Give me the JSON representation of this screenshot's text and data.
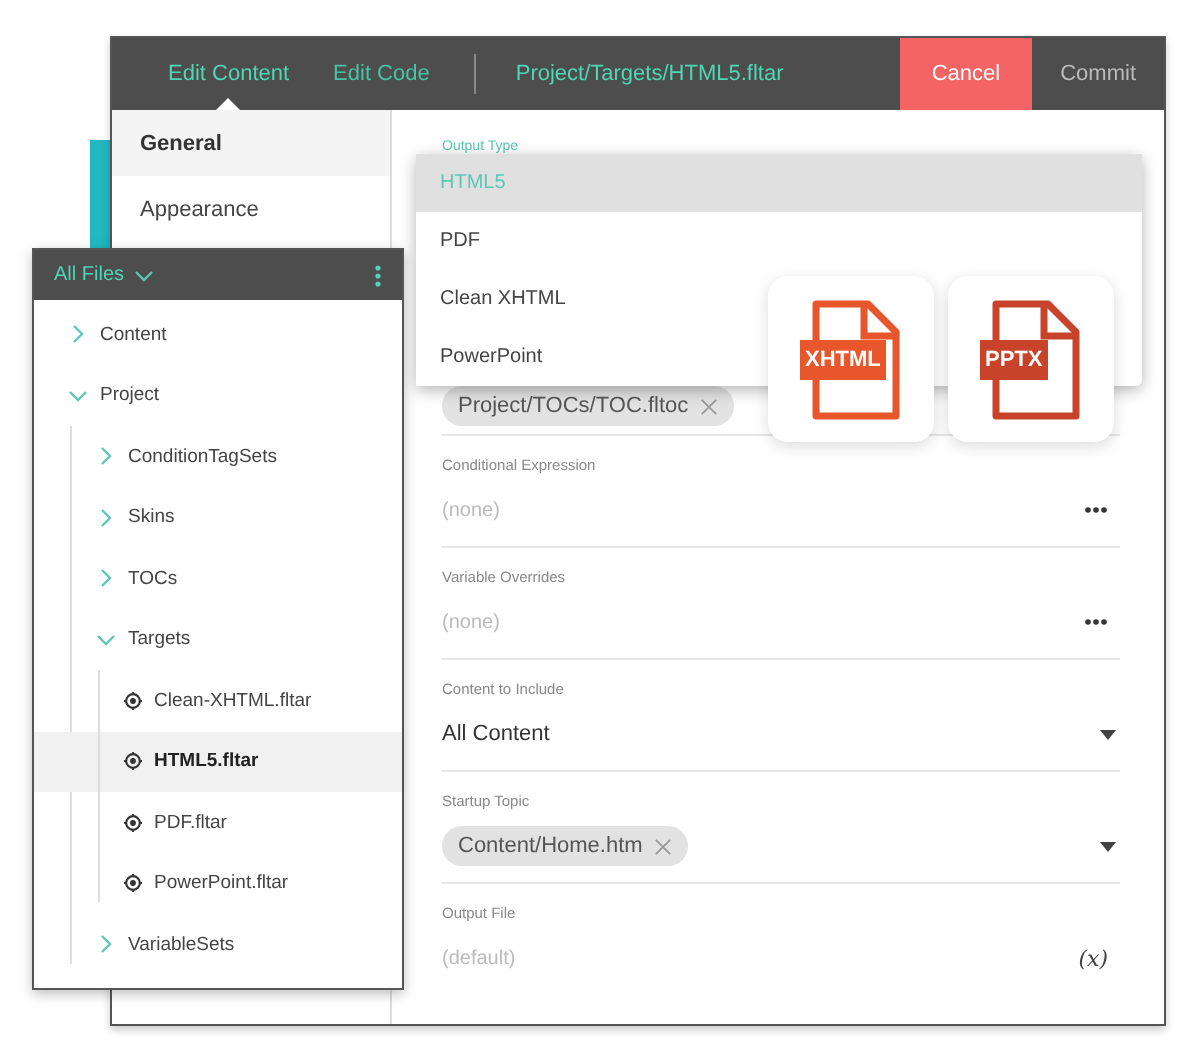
{
  "header": {
    "tabs": [
      {
        "label": "Edit Content",
        "selected": true
      },
      {
        "label": "Edit Code",
        "selected": false
      }
    ],
    "path": "Project/Targets/HTML5.fltar",
    "buttons": [
      {
        "label": "Cancel",
        "kind": "danger"
      },
      {
        "label": "Commit",
        "kind": "plain"
      }
    ]
  },
  "nav": [
    {
      "label": "General",
      "selected": true
    },
    {
      "label": "Appearance",
      "selected": false
    }
  ],
  "output_type": {
    "label": "Output Type",
    "options": [
      {
        "label": "HTML5",
        "selected": true
      },
      {
        "label": "PDF",
        "selected": false
      },
      {
        "label": "Clean XHTML",
        "selected": false
      },
      {
        "label": "PowerPoint",
        "selected": false
      }
    ]
  },
  "fields": [
    {
      "kind": "chip",
      "value": "Project/TOCs/TOC.fltoc"
    },
    {
      "kind": "ellipsis",
      "label": "Conditional Expression",
      "placeholder": "(none)"
    },
    {
      "kind": "ellipsis",
      "label": "Variable Overrides",
      "placeholder": "(none)"
    },
    {
      "kind": "select",
      "label": "Content to Include",
      "value": "All Content"
    },
    {
      "kind": "chip_select",
      "label": "Startup Topic",
      "value": "Content/Home.htm"
    },
    {
      "kind": "expression",
      "label": "Output File",
      "placeholder": "(default)",
      "action": "(x)"
    }
  ],
  "format_icons": [
    {
      "label": "XHTML",
      "color": "#e8572c"
    },
    {
      "label": "PPTX",
      "color": "#c9432b"
    }
  ],
  "tree": {
    "title": "All Files",
    "items": [
      {
        "kind": "folder",
        "label": "Content",
        "expanded": false,
        "selected": false
      },
      {
        "kind": "folder",
        "label": "Project",
        "expanded": true,
        "selected": false,
        "children": [
          {
            "kind": "folder",
            "label": "ConditionTagSets",
            "expanded": false,
            "selected": false
          },
          {
            "kind": "folder",
            "label": "Skins",
            "expanded": false,
            "selected": false
          },
          {
            "kind": "folder",
            "label": "TOCs",
            "expanded": false,
            "selected": false
          },
          {
            "kind": "folder",
            "label": "Targets",
            "expanded": true,
            "selected": false,
            "children": [
              {
                "kind": "file",
                "label": "Clean-XHTML.fltar",
                "selected": false
              },
              {
                "kind": "file",
                "label": "HTML5.fltar",
                "selected": true
              },
              {
                "kind": "file",
                "label": "PDF.fltar",
                "selected": false
              },
              {
                "kind": "file",
                "label": "PowerPoint.fltar",
                "selected": false
              }
            ]
          },
          {
            "kind": "folder",
            "label": "VariableSets",
            "expanded": false,
            "selected": false
          }
        ]
      }
    ]
  }
}
